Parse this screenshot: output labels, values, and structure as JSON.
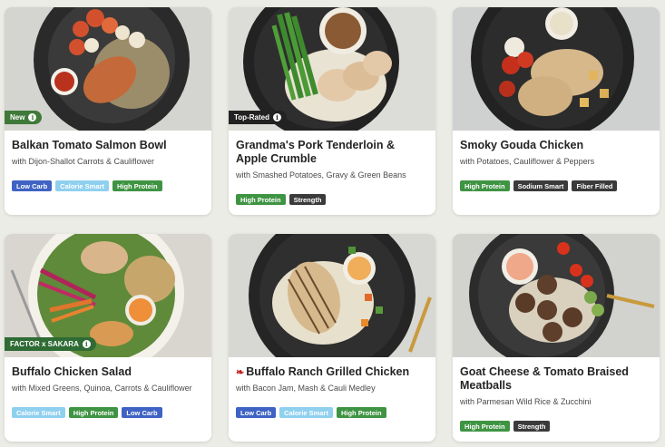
{
  "meals": [
    {
      "title": "Balkan Tomato Salmon Bowl",
      "subtitle": "with Dijon-Shallot Carrots & Cauliflower",
      "badge": "New",
      "tags": [
        "Low Carb",
        "Calorie Smart",
        "High Protein"
      ]
    },
    {
      "title": "Grandma's Pork Tenderloin & Apple Crumble",
      "subtitle": "with Smashed Potatoes, Gravy & Green Beans",
      "badge": "Top-Rated",
      "tags": [
        "High Protein",
        "Strength"
      ]
    },
    {
      "title": "Smoky Gouda Chicken",
      "subtitle": "with Potatoes, Cauliflower & Peppers",
      "badge": "",
      "tags": [
        "High Protein",
        "Sodium Smart",
        "Fiber Filled"
      ]
    },
    {
      "title": "Buffalo Chicken Salad",
      "subtitle": "with Mixed Greens, Quinoa, Carrots & Cauliflower",
      "badge": "FACTOR x SAKARA",
      "tags": [
        "Calorie Smart",
        "High Protein",
        "Low Carb"
      ]
    },
    {
      "title": "Buffalo Ranch Grilled Chicken",
      "subtitle": "with Bacon Jam, Mash & Cauli Medley",
      "badge": "",
      "spicy": true,
      "tags": [
        "Low Carb",
        "Calorie Smart",
        "High Protein"
      ]
    },
    {
      "title": "Goat Cheese & Tomato Braised Meatballs",
      "subtitle": "with Parmesan Wild Rice & Zucchini",
      "badge": "",
      "tags": [
        "High Protein",
        "Strength"
      ]
    }
  ],
  "colors": {
    "badge_new": "#3f7a3a",
    "badge_top_rated": "#222222",
    "badge_collab": "#2f6b34",
    "spicy_icon": "#c41e1e"
  },
  "icons": {
    "info": "info-icon",
    "spicy": "chili-pepper-icon"
  }
}
